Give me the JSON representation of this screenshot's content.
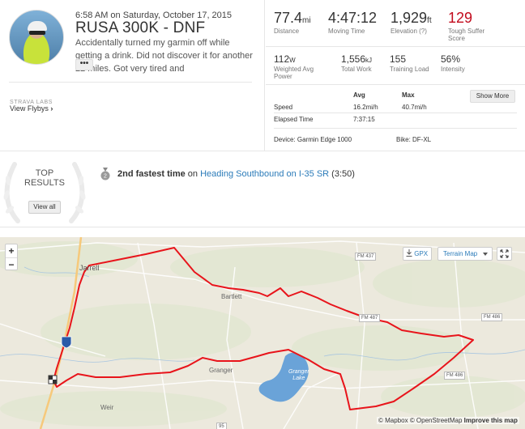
{
  "activity": {
    "date": "6:58 AM on Saturday, October 17, 2015",
    "title": "RUSA 300K - DNF",
    "description": "Accidentally turned my garmin off while getting a drink. Did not discover it for another 22 miles. Got very tired and",
    "more_label": "•••"
  },
  "labs": {
    "label": "STRAVA LABS",
    "flyby_label": "View Flybys"
  },
  "stats_primary": [
    {
      "value": "77.4",
      "unit": "mi",
      "label": "Distance"
    },
    {
      "value": "4:47:12",
      "unit": "",
      "label": "Moving Time"
    },
    {
      "value": "1,929",
      "unit": "ft",
      "label": "Elevation (?)"
    },
    {
      "value": "129",
      "unit": "",
      "label": "Tough Suffer Score"
    }
  ],
  "stats_secondary": [
    {
      "value": "112",
      "unit": "W",
      "label": "Weighted Avg Power"
    },
    {
      "value": "1,556",
      "unit": "kJ",
      "label": "Total Work"
    },
    {
      "value": "155",
      "unit": "",
      "label": "Training Load"
    },
    {
      "value": "56%",
      "unit": "",
      "label": "Intensity"
    }
  ],
  "details": {
    "col_avg": "Avg",
    "col_max": "Max",
    "speed_label": "Speed",
    "speed_avg": "16.2mi/h",
    "speed_max": "40.7mi/h",
    "elapsed_label": "Elapsed Time",
    "elapsed_value": "7:37:15",
    "show_more": "Show More",
    "device": "Device: Garmin Edge 1000",
    "bike": "Bike: DF-XL"
  },
  "results": {
    "top_label_1": "TOP",
    "top_label_2": "RESULTS",
    "view_all": "View all",
    "medal_number": "2",
    "achievement_strong": "2nd fastest time",
    "achievement_on": " on ",
    "segment_name": "Heading Southbound on I-35 SR",
    "segment_time": " (3:50)"
  },
  "map": {
    "zoom_in": "+",
    "zoom_out": "−",
    "gpx_label": "GPX",
    "terrain_label": "Terrain Map",
    "towns": {
      "jarrell": "Jarrell",
      "bartlett": "Bartlett",
      "granger": "Granger",
      "weir": "Weir"
    },
    "lake_label_1": "Granger",
    "lake_label_2": "Lake",
    "roads": {
      "fm437": "FM 437",
      "fm487": "FM 487",
      "fm486a": "FM 486",
      "fm486b": "FM 486",
      "i35": "35",
      "r95": "95"
    },
    "attribution_mapbox": "© Mapbox",
    "attribution_osm": "© OpenStreetMap",
    "attribution_improve": "Improve this map",
    "route_color": "#e8141b"
  }
}
